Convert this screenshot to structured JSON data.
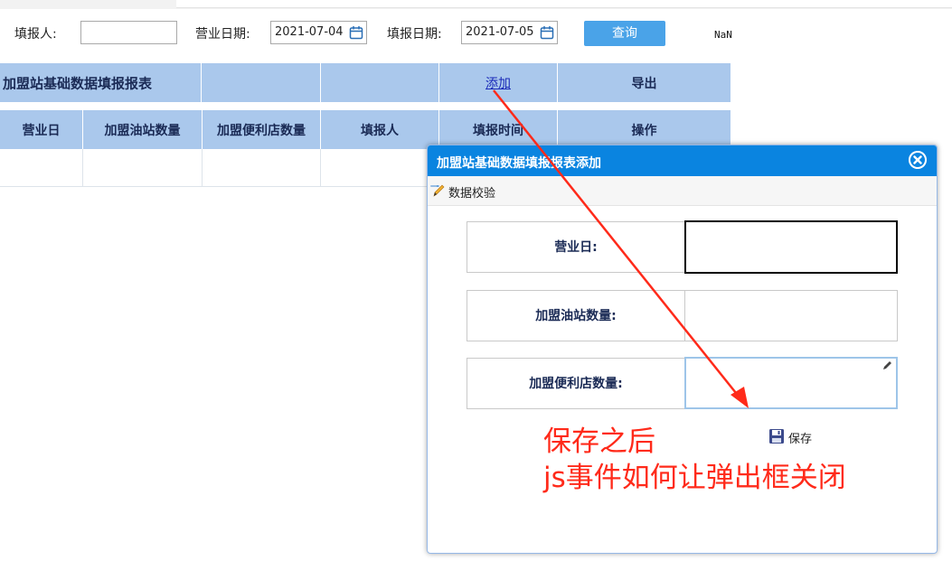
{
  "filter": {
    "filler_label": "填报人:",
    "filler_value": "",
    "business_date_label": "营业日期:",
    "business_date_value": "2021-07-04",
    "report_date_label": "填报日期:",
    "report_date_value": "2021-07-05",
    "query_button": "查询",
    "status_text": "NaN"
  },
  "table": {
    "title": "加盟站基础数据填报报表",
    "add_link": "添加",
    "export_label": "导出",
    "columns": [
      "营业日",
      "加盟油站数量",
      "加盟便利店数量",
      "填报人",
      "填报时间",
      "操作"
    ]
  },
  "modal": {
    "title": "加盟站基础数据填报报表添加",
    "toolbar_label": "数据校验",
    "fields": [
      {
        "label": "营业日:",
        "value": ""
      },
      {
        "label": "加盟油站数量:",
        "value": ""
      },
      {
        "label": "加盟便利店数量:",
        "value": ""
      }
    ],
    "save_label": "保存"
  },
  "annotation": {
    "line1": "保存之后",
    "line2": "js事件如何让弹出框关闭"
  },
  "colors": {
    "header_bg": "#aac8ec",
    "modal_header": "#0a84e0",
    "query_button": "#4aa3e8",
    "annotation": "#ff2a1a"
  }
}
